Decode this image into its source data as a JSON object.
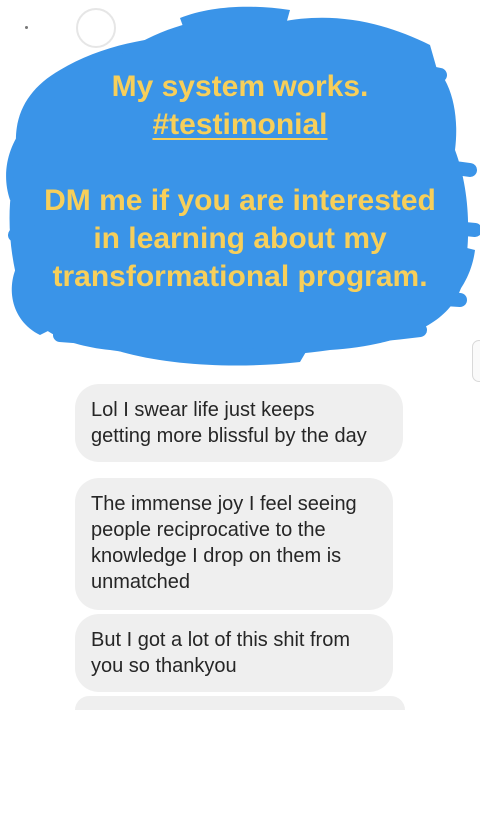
{
  "overlay": {
    "line1": "My system works.",
    "line2": "#testimonial",
    "line3": "DM me if you are interested",
    "line4": "in learning about my",
    "line5": "transformational program.",
    "text_color": "#f7cf5a",
    "scribble_color": "#3a94e8"
  },
  "messages": [
    {
      "lines": [
        "Lol I swear life just keeps",
        "getting more blissful by the day"
      ]
    },
    {
      "lines": [
        "The immense joy I feel seeing",
        "people reciprocative to the",
        "knowledge I drop on them is",
        "unmatched"
      ]
    },
    {
      "lines": [
        "But I got a lot of this shit from",
        "you so thankyou"
      ]
    }
  ],
  "colors": {
    "bubble_bg": "#efefef",
    "bubble_text": "#262626",
    "background": "#ffffff"
  }
}
